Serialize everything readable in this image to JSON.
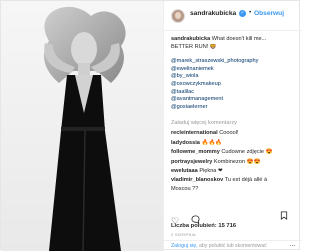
{
  "header": {
    "username": "sandrakubicka",
    "separator": "•",
    "follow_label": "Obserwuj"
  },
  "caption": {
    "username": "sandrakubicka",
    "text": "What doesn't kill me...",
    "text2": "BETTER RUN! 🦁",
    "tags": [
      "@marek_straszewski_photography",
      "@ewelinaniemek",
      "@by_wiola",
      "@osowczykmakeup",
      "@taalilac",
      "@avantmanagement",
      "@gosiaelerner"
    ]
  },
  "load_more": "Załaduj więcej komentarzy",
  "comments": [
    {
      "user": "recleinternational",
      "text": "Cooool!"
    },
    {
      "user": "ladydossia",
      "text": "🔥🔥🔥"
    },
    {
      "user": "followme_mommy",
      "text": "Cudowne zdjęcie 😍"
    },
    {
      "user": "portraysjewelry",
      "text": "Kombinezon 😍😍"
    },
    {
      "user": "ewelutaaa",
      "text": "Piękna ❤"
    },
    {
      "user": "vladimir_blanoskov",
      "text": "Tu est déjà allé à"
    },
    {
      "user": "",
      "text": "Moscou ??"
    }
  ],
  "icons": {
    "like": "heart-icon",
    "comment": "comment-icon",
    "save": "bookmark-icon"
  },
  "likes": "Liczba polubień: 15 716",
  "date": "2 SIERPNIA",
  "footer": {
    "login": "Zaloguj się,",
    "rest": "aby polubić lub skomentować",
    "more": "…"
  },
  "colors": {
    "link": "#3897f0",
    "text": "#262626",
    "muted": "#999999"
  }
}
